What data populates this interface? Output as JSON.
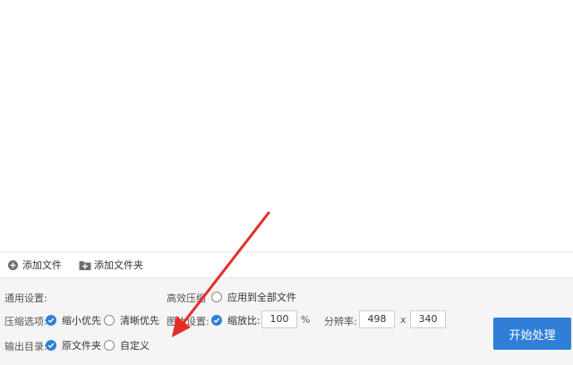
{
  "toolbar": {
    "add_file": "添加文件",
    "add_folder": "添加文件夹"
  },
  "settings": {
    "general_label": "通用设置:",
    "high_compress_label": "高效压缩",
    "apply_all": "应用到全部文件",
    "compress_options_label": "压缩选项:",
    "option_small": "缩小优先",
    "option_clear": "清晰优先",
    "image_settings_label": "图片设置:",
    "scale_label": "缩放比:",
    "scale_value": "100",
    "percent_unit": "%",
    "resolution_label": "分辨率:",
    "width_value": "498",
    "times": "x",
    "height_value": "340",
    "output_dir_label": "输出目录:",
    "dir_original": "原文件夹",
    "dir_custom": "自定义"
  },
  "start_button": "开始处理",
  "colors": {
    "accent": "#2f7fd8",
    "annotation_arrow": "#e52e2a"
  },
  "icons": {
    "add_file": "plus-circle-icon",
    "add_folder": "folder-plus-icon",
    "checked": "check-icon"
  }
}
